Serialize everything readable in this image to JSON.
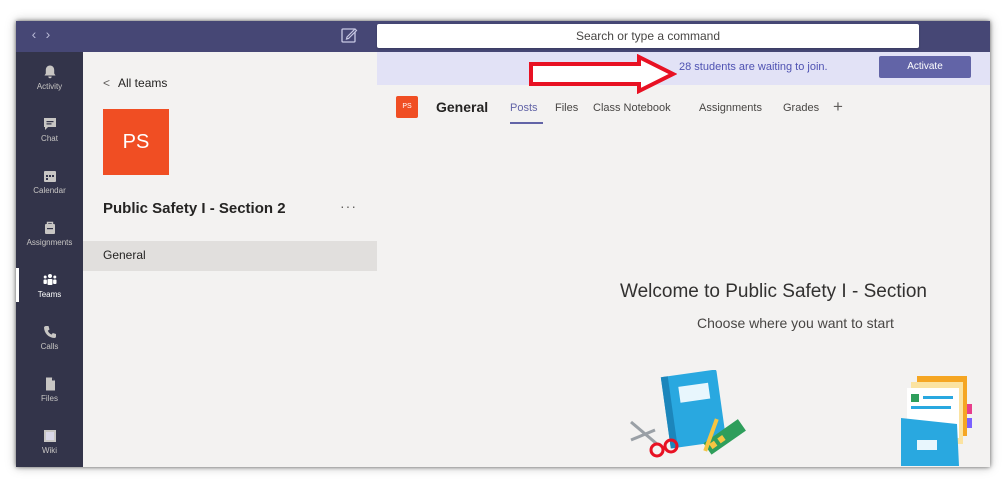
{
  "topbar": {
    "search_placeholder": "Search or type a command",
    "nav_back": "‹",
    "nav_forward": "›"
  },
  "rail": {
    "items": [
      {
        "label": "Activity",
        "icon": "bell-icon"
      },
      {
        "label": "Chat",
        "icon": "chat-icon"
      },
      {
        "label": "Calendar",
        "icon": "calendar-icon"
      },
      {
        "label": "Assignments",
        "icon": "assignments-icon"
      },
      {
        "label": "Teams",
        "icon": "teams-icon",
        "active": true
      },
      {
        "label": "Calls",
        "icon": "phone-icon"
      },
      {
        "label": "Files",
        "icon": "file-icon"
      },
      {
        "label": "Wiki",
        "icon": "wiki-icon"
      }
    ]
  },
  "teampane": {
    "back_label": "All teams",
    "team_initials": "PS",
    "team_name": "Public Safety I - Section 2",
    "more": "···",
    "channel": "General"
  },
  "banner": {
    "text": "28 students are waiting to join.",
    "activate_label": "Activate"
  },
  "channel": {
    "initials": "PS",
    "name": "General",
    "tabs": [
      "Posts",
      "Files",
      "Class Notebook",
      "Assignments",
      "Grades"
    ],
    "add_tab": "+"
  },
  "welcome": {
    "title": "Welcome to Public Safety I - Section",
    "subtitle": "Choose where you want to start"
  },
  "colors": {
    "topbar": "#464775",
    "rail": "#33344a",
    "accent": "#6264a7",
    "team_tile": "#f04e23",
    "arrow": "#e81123"
  }
}
